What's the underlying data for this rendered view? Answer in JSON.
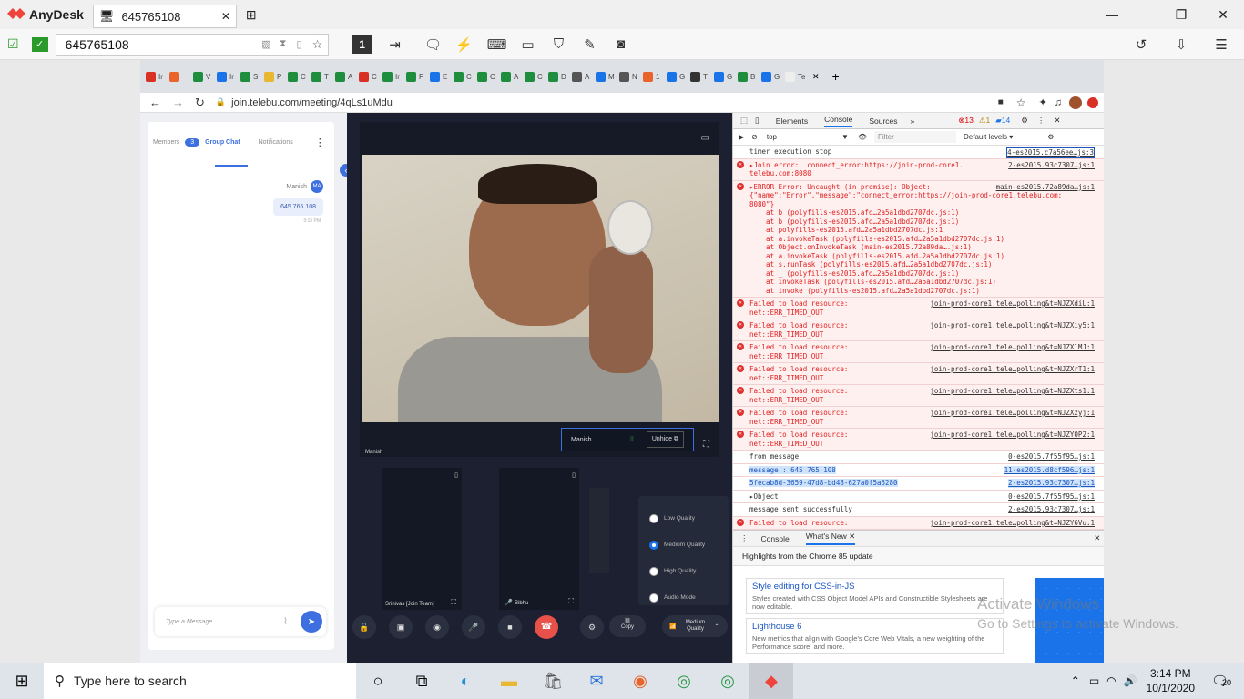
{
  "anydesk": {
    "app_name": "AnyDesk",
    "tab_id": "645765108",
    "address_value": "645765108",
    "monitor_number": "1",
    "colors": {
      "brand": "#ef443b"
    }
  },
  "chrome": {
    "tabs": [
      "Ir",
      "",
      "V",
      "Ir",
      "S",
      "P",
      "C",
      "T",
      "A",
      "C",
      "Ir",
      "F",
      "E",
      "C",
      "C",
      "A",
      "C",
      "D",
      "A",
      "M",
      "N",
      "1",
      "G",
      "T",
      "G",
      "B",
      "G",
      "Te"
    ],
    "url": "join.telebu.com/meeting/4qLs1uMdu"
  },
  "meeting": {
    "tabs": {
      "members": "Members",
      "members_count": "3",
      "group_chat": "Group Chat",
      "notifications": "Notifications"
    },
    "chat": {
      "sender": "Manish",
      "sender_initials": "MA",
      "message": "645 765 108",
      "time": "3:15 PM",
      "input_placeholder": "Type a Message"
    },
    "main_participant": "Manish",
    "pinned": {
      "name": "Manish",
      "unhide_label": "Unhide"
    },
    "participants": [
      {
        "name": "Srinivas [Join Team]"
      },
      {
        "name": "Bibhu"
      }
    ],
    "quality_options": [
      {
        "label": "Low Quality",
        "selected": false
      },
      {
        "label": "Medium Quality",
        "selected": true
      },
      {
        "label": "High Quality",
        "selected": false
      },
      {
        "label": "Audio Mode",
        "selected": false
      }
    ],
    "controls": {
      "copy_label": "Copy",
      "quality_label": "Medium Quality"
    }
  },
  "devtools": {
    "tabs": [
      "Elements",
      "Console",
      "Sources"
    ],
    "active_tab": "Console",
    "counts": {
      "errors": "13",
      "warnings": "1",
      "messages": "14"
    },
    "context": "top",
    "filter_placeholder": "Filter",
    "levels": "Default levels",
    "logs": [
      {
        "type": "info",
        "text": "timer execution stop",
        "source": "4-es2015.c7a56ee…js:3",
        "boxed": true
      },
      {
        "type": "error",
        "text": "▸Join error:  connect_error:https://join-prod-core1.\ntelebu.com:8080",
        "source": "2-es2015.93c7307…js:1"
      },
      {
        "type": "error",
        "text": "▸ERROR Error: Uncaught (in promise): Object:\n{\"name\":\"Error\",\"message\":\"connect_error:https://join-prod-core1.telebu.com:\n8080\"}\n    at b (polyfills-es2015.afd…2a5a1dbd2707dc.js:1)\n    at b (polyfills-es2015.afd…2a5a1dbd2707dc.js:1)\n    at polyfills-es2015.afd…2a5a1dbd2707dc.js:1\n    at a.invokeTask (polyfills-es2015.afd…2a5a1dbd2707dc.js:1)\n    at Object.onInvokeTask (main-es2015.72a89da….js:1)\n    at a.invokeTask (polyfills-es2015.afd…2a5a1dbd2707dc.js:1)\n    at s.runTask (polyfills-es2015.afd…2a5a1dbd2707dc.js:1)\n    at _ (polyfills-es2015.afd…2a5a1dbd2707dc.js:1)\n    at invokeTask (polyfills-es2015.afd…2a5a1dbd2707dc.js:1)\n    at invoke (polyfills-es2015.afd…2a5a1dbd2707dc.js:1)",
        "source": "main-es2015.72a89da…js:1"
      },
      {
        "type": "error",
        "text": "Failed to load resource:\nnet::ERR_TIMED_OUT",
        "source": "join-prod-core1.tele…polling&t=NJZXdiL:1"
      },
      {
        "type": "error",
        "text": "Failed to load resource:\nnet::ERR_TIMED_OUT",
        "source": "join-prod-core1.tele…polling&t=NJZXiy5:1"
      },
      {
        "type": "error",
        "text": "Failed to load resource:\nnet::ERR_TIMED_OUT",
        "source": "join-prod-core1.tele…polling&t=NJZXlMJ:1"
      },
      {
        "type": "error",
        "text": "Failed to load resource:\nnet::ERR_TIMED_OUT",
        "source": "join-prod-core1.tele…polling&t=NJZXrT1:1"
      },
      {
        "type": "error",
        "text": "Failed to load resource:\nnet::ERR_TIMED_OUT",
        "source": "join-prod-core1.tele…polling&t=NJZXts1:1"
      },
      {
        "type": "error",
        "text": "Failed to load resource:\nnet::ERR_TIMED_OUT",
        "source": "join-prod-core1.tele…polling&t=NJZXzyj:1"
      },
      {
        "type": "error",
        "text": "Failed to load resource:\nnet::ERR_TIMED_OUT",
        "source": "join-prod-core1.tele…polling&t=NJZY0P2:1"
      },
      {
        "type": "info",
        "text": "from message",
        "source": "0-es2015.7f55f95…js:1"
      },
      {
        "type": "selected",
        "text": "message : 645 765 108",
        "source": "11-es2015.d8cf596…js:1"
      },
      {
        "type": "selected",
        "text": "5fecab8d-3659-47d8-bd48-627a0f5a5280",
        "source": "2-es2015.93c7307…js:1"
      },
      {
        "type": "info",
        "text": "▸Object",
        "source": "0-es2015.7f55f95…js:1"
      },
      {
        "type": "info",
        "text": "message sent successfully",
        "source": "2-es2015.93c7307…js:1"
      },
      {
        "type": "error",
        "text": "Failed to load resource:",
        "source": "join-prod-core1.tele…polling&t=NJZY6Vu:1"
      }
    ],
    "drawer": {
      "tabs": [
        "Console",
        "What's New"
      ],
      "headline": "Highlights from the Chrome 85 update",
      "cards": [
        {
          "title": "Style editing for CSS-in-JS",
          "body": "Styles created with CSS Object Model APIs and Constructible Stylesheets are now editable."
        },
        {
          "title": "Lighthouse 6",
          "body": "New metrics that align with Google's Core Web Vitals, a new weighting of the Performance score, and more."
        }
      ]
    }
  },
  "watermark": {
    "line1": "Activate Windows",
    "line2": "Go to Settings to activate Windows."
  },
  "taskbar": {
    "search_placeholder": "Type here to search",
    "time": "3:14 PM",
    "date": "10/1/2020",
    "notification_count": "20"
  }
}
